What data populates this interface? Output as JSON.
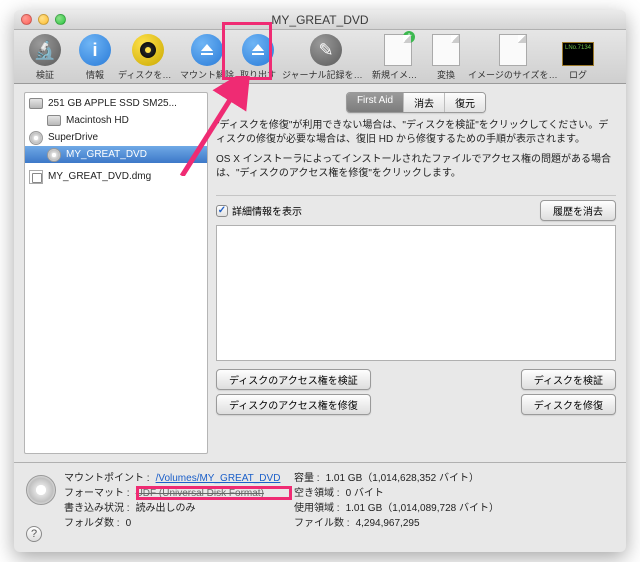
{
  "window": {
    "title": "MY_GREAT_DVD"
  },
  "toolbar": {
    "verify": "検証",
    "info": "情報",
    "burn": "ディスクを作成",
    "unmount": "マウント解除",
    "eject": "取り出す",
    "journal": "ジャーナル記録を開始",
    "newimage": "新規イメージ",
    "convert": "変換",
    "resize": "イメージのサイズを変更",
    "log": "ログ"
  },
  "sidebar": {
    "drive0": "251 GB APPLE SSD SM25...",
    "vol0": "Macintosh HD",
    "drive1": "SuperDrive",
    "vol1": "MY_GREAT_DVD",
    "dmg": "MY_GREAT_DVD.dmg"
  },
  "tabs": {
    "firstaid": "First Aid",
    "erase": "消去",
    "restore": "復元"
  },
  "help": {
    "p1": "\"ディスクを修復\"が利用できない場合は、\"ディスクを検証\"をクリックしてください。ディスクの修復が必要な場合は、復旧 HD から修復するための手順が表示されます。",
    "p2": "OS X インストーラによってインストールされたファイルでアクセス権の問題がある場合は、\"ディスクのアクセス権を修復\"をクリックします。"
  },
  "details": {
    "show": "詳細情報を表示",
    "clear": "履歴を消去"
  },
  "actions": {
    "verify_perm": "ディスクのアクセス権を検証",
    "repair_perm": "ディスクのアクセス権を修復",
    "verify_disk": "ディスクを検証",
    "repair_disk": "ディスクを修復"
  },
  "footer": {
    "mount_label": "マウントポイント :",
    "mount_value": "/Volumes/MY_GREAT_DVD",
    "format_label": "フォーマット :",
    "format_value": "UDF (Universal Disk Format)",
    "write_label": "書き込み状況 :",
    "write_value": "読み出しのみ",
    "folders_label": "フォルダ数 :",
    "folders_value": "0",
    "capacity_label": "容量 :",
    "capacity_value": "1.01 GB（1,014,628,352 バイト）",
    "avail_label": "空き領域 :",
    "avail_value": "0 バイト",
    "used_label": "使用領域 :",
    "used_value": "1.01 GB（1,014,089,728 バイト）",
    "files_label": "ファイル数 :",
    "files_value": "4,294,967,295"
  },
  "log_text": "LNo.7134"
}
